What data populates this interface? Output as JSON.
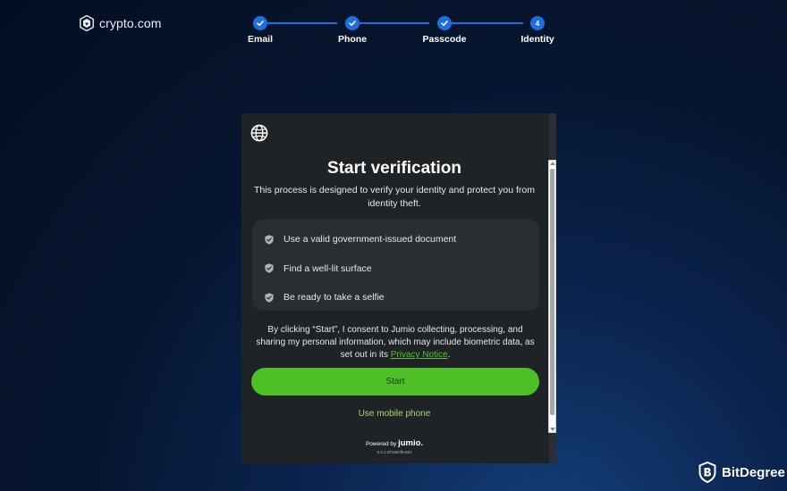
{
  "brand": {
    "name": "crypto.com",
    "icon": "crypto-com-logo-icon"
  },
  "stepper": {
    "accent_color": "#1c6fe0",
    "steps": [
      {
        "label": "Email",
        "state": "complete",
        "icon": "check-icon"
      },
      {
        "label": "Phone",
        "state": "complete",
        "icon": "check-icon"
      },
      {
        "label": "Passcode",
        "state": "complete",
        "icon": "check-icon"
      },
      {
        "label": "Identity",
        "state": "current",
        "number": "4"
      }
    ]
  },
  "verification": {
    "language_icon": "globe-icon",
    "title": "Start verification",
    "subtitle": "This process is designed to verify your identity and protect you from identity theft.",
    "checklist": [
      {
        "icon": "shield-check-icon",
        "text": "Use a valid government-issued document"
      },
      {
        "icon": "shield-check-icon",
        "text": "Find a well-lit surface"
      },
      {
        "icon": "shield-check-icon",
        "text": "Be ready to take a selfie"
      }
    ],
    "consent_prefix": "By clicking “Start”, I consent to Jumio collecting, processing, and sharing my personal information, which may include biometric data, as set out in its ",
    "privacy_link": "Privacy Notice",
    "consent_suffix": ".",
    "start_button": "Start",
    "mobile_link": "Use mobile phone",
    "powered_by": "Powered by",
    "powered_brand": "jumio.",
    "version": "0.3.1-d71667f5.651",
    "button_color": "#4fbf26"
  },
  "watermark": {
    "text": "BitDegree",
    "icon": "bitdegree-shield-icon"
  }
}
